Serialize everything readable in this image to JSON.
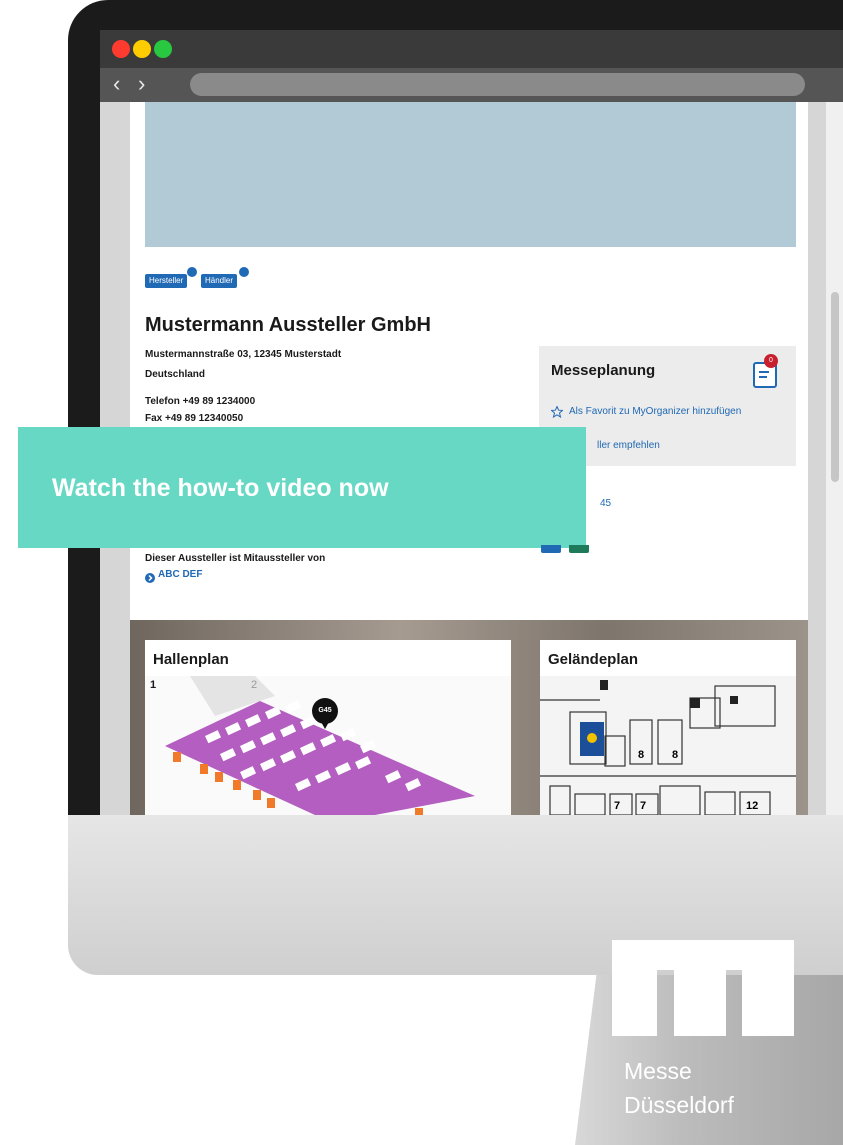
{
  "browser": {
    "traffic_lights": [
      "#ff3b30",
      "#ffcc00",
      "#28c840"
    ],
    "nav_back": "‹",
    "nav_forward": "›"
  },
  "exhibitor": {
    "tags": [
      "Hersteller",
      "Händler"
    ],
    "name": "Mustermann Aussteller GmbH",
    "street": "Mustermannstraße 03, 12345 Musterstadt",
    "country": "Deutschland",
    "phone": "Telefon +49 89 1234000",
    "fax": "Fax +49 89 12340050",
    "co_exhibitor_text": "Dieser Aussteller ist Mitaussteller von",
    "co_exhibitor_link": "ABC DEF"
  },
  "planning": {
    "title": "Messeplanung",
    "badge": "0",
    "favorite_link": "Als Favorit zu MyOrganizer hinzufügen",
    "recommend_link_partial": "ller empfehlen",
    "stand_partial": "45"
  },
  "cta": {
    "label": "Watch the how-to video now",
    "color": "#67d8c4"
  },
  "maps": {
    "hall_title": "Hallenplan",
    "site_title": "Geländeplan",
    "hall_number_left": "1",
    "hall_number_right": "2",
    "stand_marker": "G45",
    "site_hall_labels": [
      "8",
      "8",
      "7",
      "7",
      "12"
    ]
  },
  "brand": {
    "line1": "Messe",
    "line2": "Düsseldorf"
  },
  "colors": {
    "accent_blue": "#2069b5",
    "banner": "#b2cad6",
    "hall_purple": "#b35ec0"
  }
}
